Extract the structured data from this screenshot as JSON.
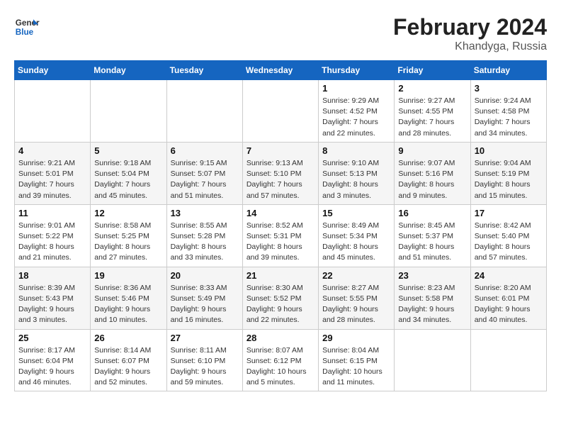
{
  "header": {
    "logo_general": "General",
    "logo_blue": "Blue",
    "month_title": "February 2024",
    "location": "Khandyga, Russia"
  },
  "weekdays": [
    "Sunday",
    "Monday",
    "Tuesday",
    "Wednesday",
    "Thursday",
    "Friday",
    "Saturday"
  ],
  "weeks": [
    [
      {
        "day": "",
        "info": ""
      },
      {
        "day": "",
        "info": ""
      },
      {
        "day": "",
        "info": ""
      },
      {
        "day": "",
        "info": ""
      },
      {
        "day": "1",
        "info": "Sunrise: 9:29 AM\nSunset: 4:52 PM\nDaylight: 7 hours\nand 22 minutes."
      },
      {
        "day": "2",
        "info": "Sunrise: 9:27 AM\nSunset: 4:55 PM\nDaylight: 7 hours\nand 28 minutes."
      },
      {
        "day": "3",
        "info": "Sunrise: 9:24 AM\nSunset: 4:58 PM\nDaylight: 7 hours\nand 34 minutes."
      }
    ],
    [
      {
        "day": "4",
        "info": "Sunrise: 9:21 AM\nSunset: 5:01 PM\nDaylight: 7 hours\nand 39 minutes."
      },
      {
        "day": "5",
        "info": "Sunrise: 9:18 AM\nSunset: 5:04 PM\nDaylight: 7 hours\nand 45 minutes."
      },
      {
        "day": "6",
        "info": "Sunrise: 9:15 AM\nSunset: 5:07 PM\nDaylight: 7 hours\nand 51 minutes."
      },
      {
        "day": "7",
        "info": "Sunrise: 9:13 AM\nSunset: 5:10 PM\nDaylight: 7 hours\nand 57 minutes."
      },
      {
        "day": "8",
        "info": "Sunrise: 9:10 AM\nSunset: 5:13 PM\nDaylight: 8 hours\nand 3 minutes."
      },
      {
        "day": "9",
        "info": "Sunrise: 9:07 AM\nSunset: 5:16 PM\nDaylight: 8 hours\nand 9 minutes."
      },
      {
        "day": "10",
        "info": "Sunrise: 9:04 AM\nSunset: 5:19 PM\nDaylight: 8 hours\nand 15 minutes."
      }
    ],
    [
      {
        "day": "11",
        "info": "Sunrise: 9:01 AM\nSunset: 5:22 PM\nDaylight: 8 hours\nand 21 minutes."
      },
      {
        "day": "12",
        "info": "Sunrise: 8:58 AM\nSunset: 5:25 PM\nDaylight: 8 hours\nand 27 minutes."
      },
      {
        "day": "13",
        "info": "Sunrise: 8:55 AM\nSunset: 5:28 PM\nDaylight: 8 hours\nand 33 minutes."
      },
      {
        "day": "14",
        "info": "Sunrise: 8:52 AM\nSunset: 5:31 PM\nDaylight: 8 hours\nand 39 minutes."
      },
      {
        "day": "15",
        "info": "Sunrise: 8:49 AM\nSunset: 5:34 PM\nDaylight: 8 hours\nand 45 minutes."
      },
      {
        "day": "16",
        "info": "Sunrise: 8:45 AM\nSunset: 5:37 PM\nDaylight: 8 hours\nand 51 minutes."
      },
      {
        "day": "17",
        "info": "Sunrise: 8:42 AM\nSunset: 5:40 PM\nDaylight: 8 hours\nand 57 minutes."
      }
    ],
    [
      {
        "day": "18",
        "info": "Sunrise: 8:39 AM\nSunset: 5:43 PM\nDaylight: 9 hours\nand 3 minutes."
      },
      {
        "day": "19",
        "info": "Sunrise: 8:36 AM\nSunset: 5:46 PM\nDaylight: 9 hours\nand 10 minutes."
      },
      {
        "day": "20",
        "info": "Sunrise: 8:33 AM\nSunset: 5:49 PM\nDaylight: 9 hours\nand 16 minutes."
      },
      {
        "day": "21",
        "info": "Sunrise: 8:30 AM\nSunset: 5:52 PM\nDaylight: 9 hours\nand 22 minutes."
      },
      {
        "day": "22",
        "info": "Sunrise: 8:27 AM\nSunset: 5:55 PM\nDaylight: 9 hours\nand 28 minutes."
      },
      {
        "day": "23",
        "info": "Sunrise: 8:23 AM\nSunset: 5:58 PM\nDaylight: 9 hours\nand 34 minutes."
      },
      {
        "day": "24",
        "info": "Sunrise: 8:20 AM\nSunset: 6:01 PM\nDaylight: 9 hours\nand 40 minutes."
      }
    ],
    [
      {
        "day": "25",
        "info": "Sunrise: 8:17 AM\nSunset: 6:04 PM\nDaylight: 9 hours\nand 46 minutes."
      },
      {
        "day": "26",
        "info": "Sunrise: 8:14 AM\nSunset: 6:07 PM\nDaylight: 9 hours\nand 52 minutes."
      },
      {
        "day": "27",
        "info": "Sunrise: 8:11 AM\nSunset: 6:10 PM\nDaylight: 9 hours\nand 59 minutes."
      },
      {
        "day": "28",
        "info": "Sunrise: 8:07 AM\nSunset: 6:12 PM\nDaylight: 10 hours\nand 5 minutes."
      },
      {
        "day": "29",
        "info": "Sunrise: 8:04 AM\nSunset: 6:15 PM\nDaylight: 10 hours\nand 11 minutes."
      },
      {
        "day": "",
        "info": ""
      },
      {
        "day": "",
        "info": ""
      }
    ]
  ]
}
